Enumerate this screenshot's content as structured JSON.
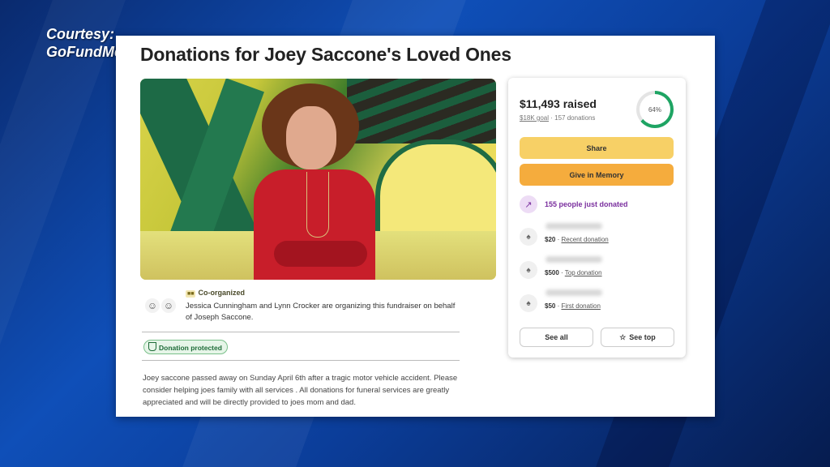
{
  "watermark": {
    "line1": "Courtesy:",
    "line2": "GoFundMe"
  },
  "page": {
    "title": "Donations for Joey Saccone's Loved Ones"
  },
  "organizers": {
    "badge": "Co-organized",
    "text": "Jessica Cunningham and Lynn Crocker are organizing this fundraiser on behalf of Joseph Saccone."
  },
  "protection": {
    "label": "Donation protected"
  },
  "story": "Joey saccone passed away on Sunday April 6th after a tragic motor vehicle accident. Please consider helping joes family with all services . All donations for funeral services are greatly appreciated and will be directly provided to joes mom and dad.",
  "summary": {
    "raised": "$11,493 raised",
    "goal": "$18K goal",
    "donations": "157 donations",
    "progress_label": "64%",
    "progress_fraction": 0.64,
    "share_label": "Share",
    "memory_label": "Give in Memory",
    "just_donated": "155 people just donated",
    "donations_list": [
      {
        "amount": "$20",
        "kind": "Recent donation"
      },
      {
        "amount": "$500",
        "kind": "Top donation"
      },
      {
        "amount": "$50",
        "kind": "First donation"
      }
    ],
    "see_all": "See all",
    "see_top": "See top"
  },
  "colors": {
    "share_button": "#f7d066",
    "memory_button": "#f5ac3d",
    "progress": "#1ea463",
    "just_donated": "#7a2f9e",
    "protected": "#1d6b37"
  },
  "icons": [
    "person-icon",
    "shield-icon",
    "trending-up-icon",
    "donor-icon",
    "star-icon"
  ]
}
